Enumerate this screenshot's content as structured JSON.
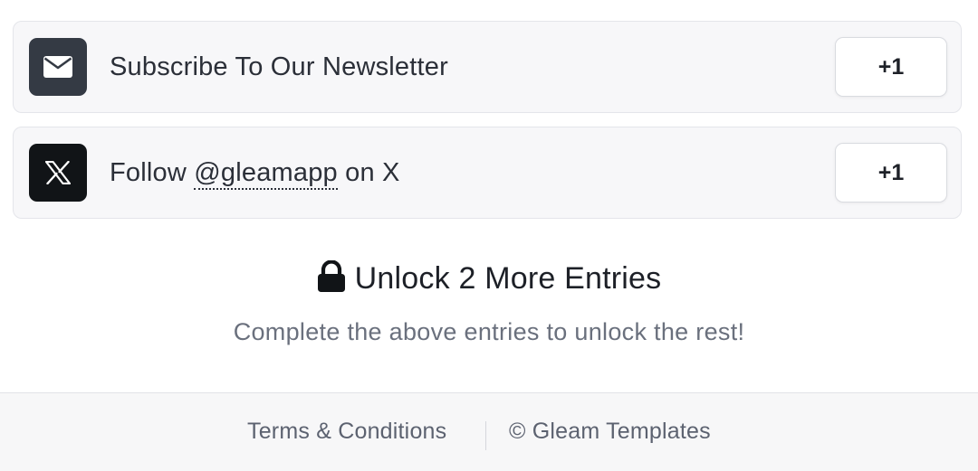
{
  "entries": [
    {
      "icon": "envelope-icon",
      "label": "Subscribe To Our Newsletter",
      "points": "+1"
    },
    {
      "icon": "x-logo-icon",
      "label_prefix": "Follow ",
      "handle": "@gleamapp",
      "label_suffix": " on X",
      "points": "+1"
    }
  ],
  "unlock": {
    "icon": "lock-icon",
    "title": "Unlock 2 More Entries",
    "subtitle": "Complete the above entries to unlock the rest!"
  },
  "footer": {
    "terms": "Terms & Conditions",
    "copyright": "© Gleam Templates"
  },
  "colors": {
    "mail_icon_bg": "#343a44",
    "x_icon_bg": "#111417",
    "entry_bg": "#f7f7f9",
    "muted_text": "#6a707d"
  }
}
